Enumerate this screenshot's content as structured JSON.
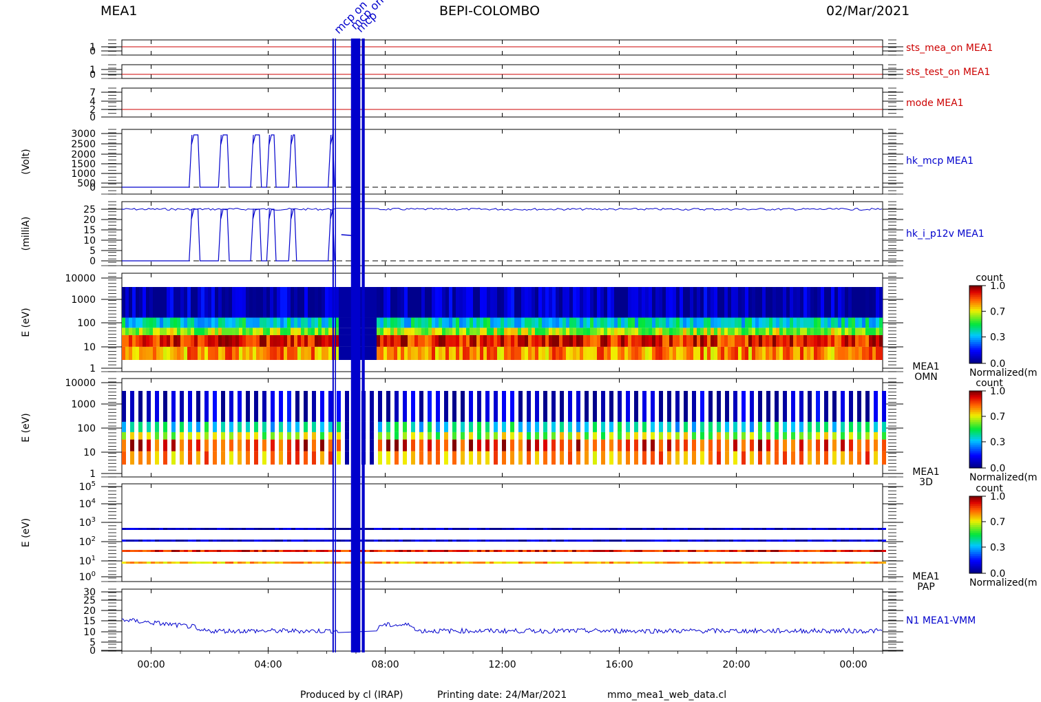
{
  "header": {
    "instrument": "MEA1",
    "mission": "BEPI-COLOMBO",
    "date": "02/Mar/2021"
  },
  "footer": {
    "credit": "Produced by cl (IRAP)",
    "printing": "Printing date: 24/Mar/2021",
    "file": "mmo_mea1_web_data.cl"
  },
  "event_labels": [
    "mcp on",
    "mcp on",
    "mcp"
  ],
  "colors": {
    "red": "#cc0000",
    "blue": "#0000cc",
    "dark_blue": "#00008b",
    "black": "#000000"
  },
  "chart_data": [
    {
      "type": "line",
      "name": "sts_mea_on MEA1",
      "ylim": [
        0,
        1
      ],
      "yticks": [
        "1",
        "0"
      ],
      "color": "#cc0000",
      "note_values": "flag trace near 1 across the day"
    },
    {
      "type": "line",
      "name": "sts_test_on MEA1",
      "ylim": [
        0,
        1
      ],
      "yticks": [
        "1",
        "0"
      ],
      "color": "#cc0000"
    },
    {
      "type": "line",
      "name": "mode MEA1",
      "ylim": [
        0,
        7
      ],
      "yticks": [
        "7",
        "4",
        "2",
        "0"
      ],
      "color": "#cc0000"
    },
    {
      "type": "line",
      "name": "hk_mcp MEA1",
      "ylabel": "(Volt)",
      "ylim": [
        0,
        3000
      ],
      "yticks": [
        "3000",
        "2500",
        "2000",
        "1500",
        "1000",
        "500",
        "0"
      ],
      "color": "#0000cc"
    },
    {
      "type": "line",
      "name": "hk_i_p12v MEA1",
      "ylabel": "(milliA)",
      "ylim": [
        0,
        28
      ],
      "yticks": [
        "25",
        "20",
        "15",
        "10",
        "5",
        "0"
      ],
      "color": "#0000cc"
    },
    {
      "type": "heatmap",
      "name": "MEA1 OMN",
      "name_lines": [
        "MEA1",
        "OMN"
      ],
      "ylabel": "E (eV)",
      "yscale": "log",
      "ylim": [
        1,
        10000
      ],
      "yticks": [
        "10000",
        "1000",
        "100",
        "10",
        "1"
      ],
      "colorbar": {
        "label": "count",
        "sublabel": "Normalized(m",
        "ticks": [
          "1.0",
          "0.7",
          "0.3",
          "0.0"
        ]
      }
    },
    {
      "type": "heatmap",
      "name": "MEA1 3D",
      "name_lines": [
        "MEA1",
        "3D"
      ],
      "ylabel": "E (eV)",
      "yscale": "log",
      "ylim": [
        1,
        10000
      ],
      "yticks": [
        "10000",
        "1000",
        "100",
        "10",
        "1"
      ],
      "colorbar": {
        "label": "count",
        "sublabel": "Normalized(m",
        "ticks": [
          "1.0",
          "0.7",
          "0.3",
          "0.0"
        ]
      }
    },
    {
      "type": "heatmap",
      "name": "MEA1 PAP",
      "name_lines": [
        "MEA1",
        "PAP"
      ],
      "ylabel": "E (eV)",
      "yscale": "log",
      "ylim": [
        1,
        100000
      ],
      "yticks": [
        "10",
        "10",
        "10",
        "10",
        "10",
        "10"
      ],
      "ytick_exp": [
        "5",
        "4",
        "3",
        "2",
        "1",
        "0"
      ],
      "colorbar": {
        "label": "count",
        "sublabel": "Normalized(m",
        "ticks": [
          "1.0",
          "0.7",
          "0.3",
          "0.0"
        ]
      }
    },
    {
      "type": "line",
      "name": "N1 MEA1-VMM",
      "ylim": [
        0,
        30
      ],
      "yticks": [
        "30",
        "25",
        "20",
        "15",
        "10",
        "5",
        "0"
      ],
      "color": "#0000cc"
    }
  ],
  "x_axis": {
    "ticks": [
      "00:00",
      "04:00",
      "08:00",
      "12:00",
      "16:00",
      "20:00",
      "00:00"
    ],
    "range_hours": [
      -1,
      25
    ]
  }
}
